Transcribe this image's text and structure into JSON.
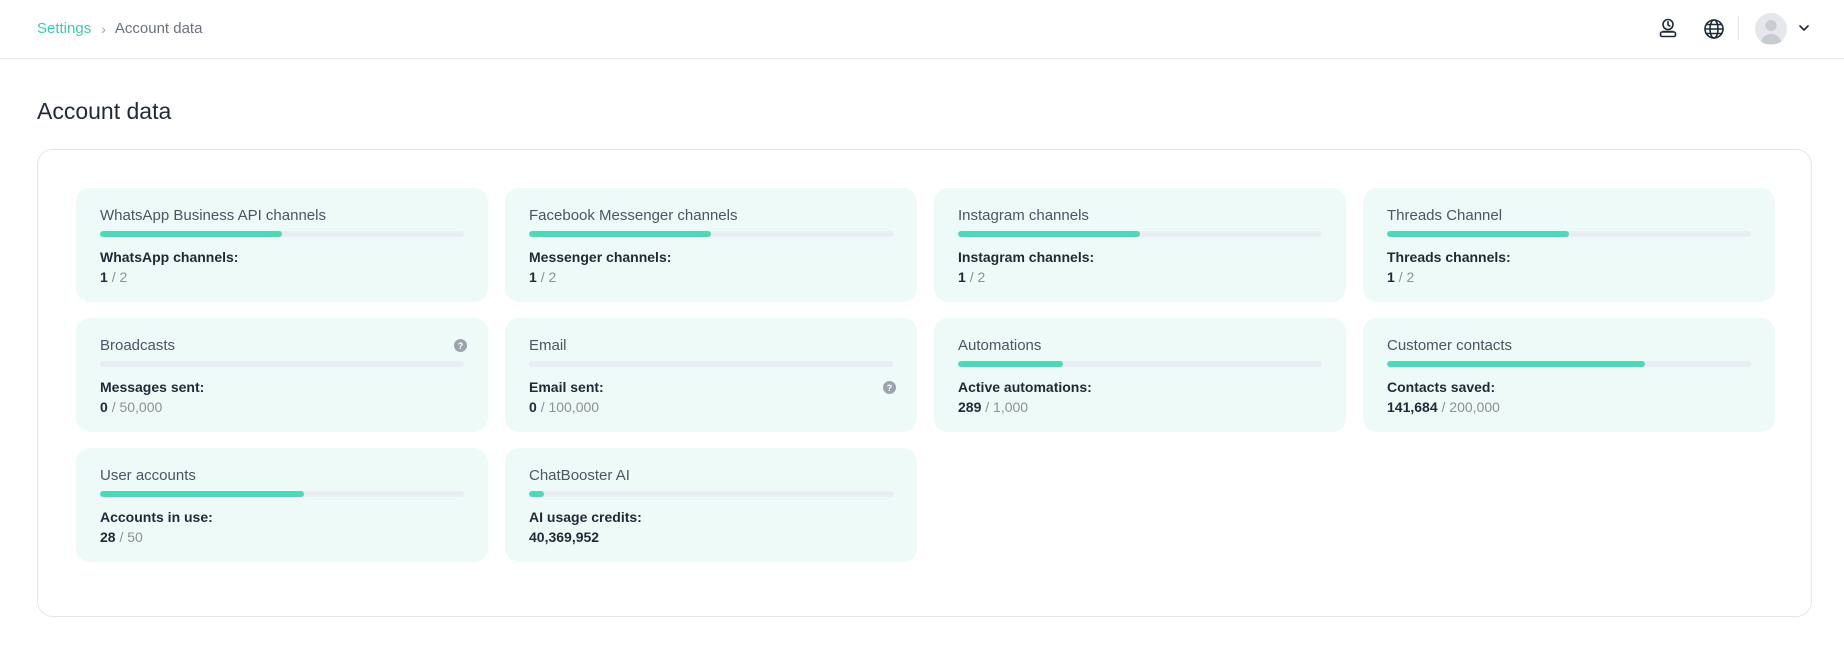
{
  "breadcrumb": {
    "parent": "Settings",
    "separator": "›",
    "current": "Account data"
  },
  "header_icons": [
    "stamp-icon",
    "globe-icon",
    "avatar",
    "chevron-down-icon"
  ],
  "page": {
    "title": "Account data"
  },
  "colors": {
    "accent": "#3ccbae",
    "bar_fill": "#4fd8b8",
    "card_bg": "#eefaf7"
  },
  "cards": [
    {
      "title": "WhatsApp Business API channels",
      "label": "WhatsApp channels:",
      "used": "1",
      "sep": "/",
      "limit": "2",
      "progress": 0.5
    },
    {
      "title": "Facebook Messenger channels",
      "label": "Messenger channels:",
      "used": "1",
      "sep": "/",
      "limit": "2",
      "progress": 0.5
    },
    {
      "title": "Instagram channels",
      "label": "Instagram channels:",
      "used": "1",
      "sep": "/",
      "limit": "2",
      "progress": 0.5
    },
    {
      "title": "Threads Channel",
      "label": "Threads channels:",
      "used": "1",
      "sep": "/",
      "limit": "2",
      "progress": 0.5
    },
    {
      "title": "Broadcasts",
      "label": "Messages sent:",
      "used": "0",
      "sep": "/",
      "limit": "50,000",
      "progress": 0,
      "help": "?"
    },
    {
      "title": "Email",
      "label": "Email sent:",
      "used": "0",
      "sep": "/",
      "limit": "100,000",
      "progress": 0,
      "help": "?"
    },
    {
      "title": "Automations",
      "label": "Active automations:",
      "used": "289",
      "sep": "/",
      "limit": "1,000",
      "progress": 0.289
    },
    {
      "title": "Customer contacts",
      "label": "Contacts saved:",
      "used": "141,684",
      "sep": "/",
      "limit": "200,000",
      "progress": 0.708
    },
    {
      "title": "User accounts",
      "label": "Accounts in use:",
      "used": "28",
      "sep": "/",
      "limit": "50",
      "progress": 0.56
    },
    {
      "title": "ChatBooster AI",
      "label": "AI usage credits:",
      "used": "40,369,952",
      "sep": "",
      "limit": "",
      "progress": 0.04
    }
  ]
}
